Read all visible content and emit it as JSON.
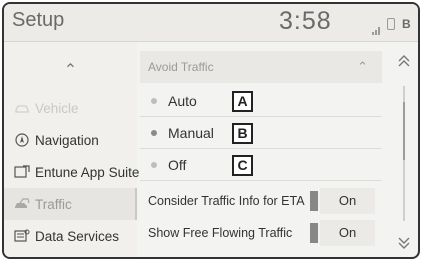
{
  "header": {
    "title": "Setup",
    "clock": "3:58",
    "bluetooth_label": "B"
  },
  "left_nav": {
    "up_glyph": "⌃",
    "items": [
      {
        "label": "Vehicle",
        "icon": "car-icon"
      },
      {
        "label": "Navigation",
        "icon": "navigation-icon"
      },
      {
        "label": "Entune App Suite",
        "icon": "entune-icon"
      },
      {
        "label": "Traffic",
        "icon": "traffic-car-icon"
      },
      {
        "label": "Data Services",
        "icon": "data-services-icon"
      }
    ]
  },
  "main": {
    "section_title": "Avoid Traffic",
    "section_chevron": "⌃",
    "options": [
      {
        "label": "Auto",
        "callout": "A"
      },
      {
        "label": "Manual",
        "callout": "B"
      },
      {
        "label": "Off",
        "callout": "C"
      }
    ],
    "toggles": [
      {
        "label": "Consider Traffic Info for ETA",
        "value": "On"
      },
      {
        "label": "Show Free Flowing Traffic",
        "value": "On"
      }
    ]
  },
  "scroll": {
    "up_glyph": "⌃",
    "down_glyph": "⌄"
  }
}
